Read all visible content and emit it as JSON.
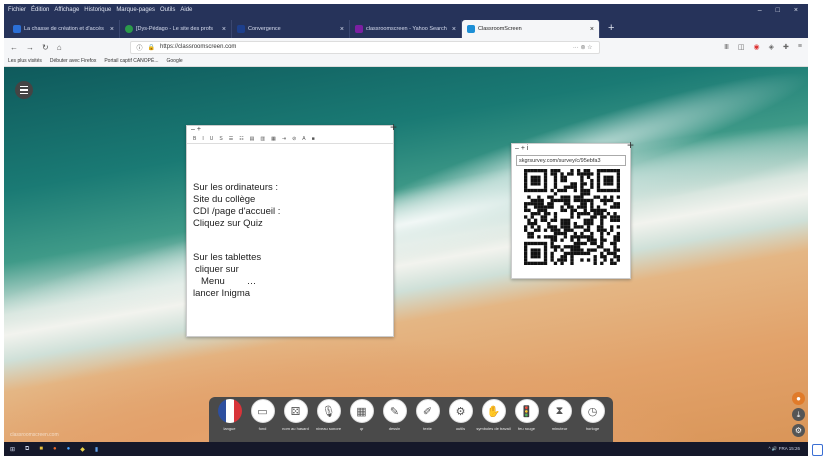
{
  "browser": {
    "menu": [
      "Fichier",
      "Édition",
      "Affichage",
      "Historique",
      "Marque-pages",
      "Outils",
      "Aide"
    ],
    "window_controls": [
      "–",
      "□",
      "×"
    ],
    "tabs": [
      {
        "label": "La chasse de création et d'accès",
        "color": "#2b6fd6"
      },
      {
        "label": "[Dys-Pédago - Le site des profs",
        "color": "#2b9a4a"
      },
      {
        "label": "Convergence",
        "color": "#1d3f8c"
      },
      {
        "label": "classroomscreen - Yahoo Search",
        "color": "#7b1fa2"
      },
      {
        "label": "ClassroomScreen",
        "color": "#1d8fd6"
      }
    ],
    "new_tab": "+",
    "url": "https://classroomscreen.com",
    "url_end": "··· ⊚ ☆",
    "bookmarks": [
      "Les plus visités",
      "Débuter avec Firefox",
      "Portail captif CANOPÉ...",
      "Google"
    ]
  },
  "note": {
    "controls": "– +",
    "plus": "+",
    "lines_a": [
      "Sur les ordinateurs :",
      "Site du collège",
      "CDI /page d'accueil :",
      "Cliquez sur Quiz"
    ],
    "lines_b": [
      "Sur les tablettes",
      "cliquer  sur",
      "Menu",
      "lancer      Inigma"
    ],
    "menu_suffix": "…"
  },
  "qr": {
    "controls": "– + i",
    "plus": "+",
    "url": "skgrsurvey.com/survey/c/95ebfa3"
  },
  "dock": {
    "tools": [
      {
        "icon": "flag",
        "label": "langue"
      },
      {
        "icon": "▭",
        "label": "fond"
      },
      {
        "icon": "⚄",
        "label": "nom au hasard"
      },
      {
        "icon": "🎙",
        "label": "niveau sonore"
      },
      {
        "icon": "▦",
        "label": "qr"
      },
      {
        "icon": "✎",
        "label": "dessin"
      },
      {
        "icon": "✐",
        "label": "texte"
      },
      {
        "icon": "⚙",
        "label": "outils"
      },
      {
        "icon": "✋",
        "label": "symboles de travail"
      },
      {
        "icon": "🚦",
        "label": "feu rouge"
      },
      {
        "icon": "⧗",
        "label": "minuteur"
      },
      {
        "icon": "◷",
        "label": "horloge"
      }
    ]
  },
  "watermark": "classroomscreen.com",
  "taskbar": {
    "tray": "^ 🔊 FRA  15:26"
  },
  "colors": {
    "flag_blue": "#2d4fa0",
    "flag_white": "#ffffff",
    "flag_red": "#d8343a"
  }
}
